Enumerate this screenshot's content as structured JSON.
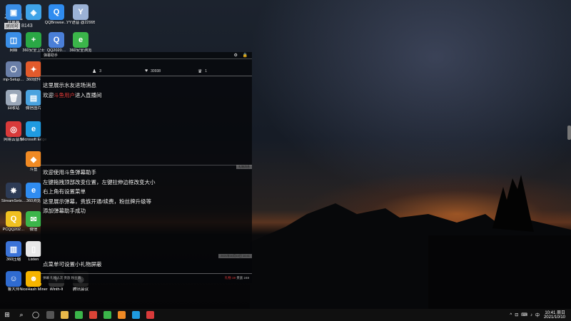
{
  "desktop_icons": [
    {
      "label": "此电脑",
      "color": "#3a8ee6",
      "glyph": "▣"
    },
    {
      "label": "",
      "color": "#3fa3e8",
      "glyph": "◈"
    },
    {
      "label": "QQBrowse…",
      "color": "#2f8cf0",
      "glyph": "Q"
    },
    {
      "label": "YY语音 @22995…",
      "color": "#9bb2d6",
      "glyph": "Y"
    },
    {
      "label": "网络",
      "color": "#3a8ee6",
      "glyph": "◫"
    },
    {
      "label": "360安全卫士",
      "color": "#2aa845",
      "glyph": "+"
    },
    {
      "label": "QQ2020…",
      "color": "#4a7fd8",
      "glyph": "Q"
    },
    {
      "label": "360安全浏览",
      "color": "#3bb54a",
      "glyph": "e"
    },
    {
      "label": "mp-Setup…",
      "color": "#6a7fa8",
      "glyph": "⎔"
    },
    {
      "label": "360软件",
      "color": "#e25a2b",
      "glyph": "✦"
    },
    {
      "label": "回收站",
      "color": "#9aa7b8",
      "glyph": "🗑"
    },
    {
      "label": "微信图片",
      "color": "#4aa3df",
      "glyph": "▤"
    },
    {
      "label": "网易云音乐",
      "color": "#d83a3a",
      "glyph": "◎"
    },
    {
      "label": "Microsoft Edge",
      "color": "#1f9be0",
      "glyph": "e"
    },
    {
      "label": "斗鱼",
      "color": "#f08a24",
      "glyph": "◆"
    },
    {
      "label": "StreamSets…",
      "color": "#2d3b55",
      "glyph": "✸"
    },
    {
      "label": "360浏览",
      "color": "#2f8cf0",
      "glyph": "e"
    },
    {
      "label": "PCQQ202…",
      "color": "#f0c020",
      "glyph": "Q"
    },
    {
      "label": "微信",
      "color": "#3bb54a",
      "glyph": "✉"
    },
    {
      "label": "360压缩",
      "color": "#3b73d8",
      "glyph": "▥"
    },
    {
      "label": "Listen",
      "color": "#e8e8e8",
      "glyph": "▯"
    },
    {
      "label": "鲁大师",
      "color": "#2f6bd0",
      "glyph": "☺"
    },
    {
      "label": "NiceHash Miner",
      "color": "#f5b400",
      "glyph": "☻"
    },
    {
      "label": "Winth-It",
      "color": "#333333",
      "glyph": "✦"
    },
    {
      "label": "腾讯会议",
      "color": "#222222",
      "glyph": "◉"
    }
  ],
  "watermark": {
    "brand": "斗鱼",
    "room_label": "房间号",
    "room_number": "8143"
  },
  "danmu": {
    "title": "弹幕助手",
    "stats": [
      {
        "icon": "♟",
        "value": "3"
      },
      {
        "icon": "♥",
        "value": "30938"
      },
      {
        "icon": "♛",
        "value": "1"
      }
    ],
    "top_messages": [
      "这里展示水友进场消息",
      {
        "prefix": "欢迎",
        "name": "斗鱼用户",
        "suffix": "进入直播间"
      }
    ],
    "separator_tag": "礼物消息",
    "chat_messages": [
      "欢迎使用斗鱼弹幕助手",
      "左键拖拽顶部改变位置，左键拉伸边框改变大小",
      "右上角有设置菜单",
      "这里展示弹幕，贵族开通/续费，粉丝牌升级等",
      "添加弹幕助手成功"
    ],
    "timestamp_tag": "2021年10月10日 10:41",
    "gift_message": "点菜单可设置小礼物屏蔽",
    "bottom_left": "弹幕 礼物人次 贵族 粉丝牌",
    "bottom_right": {
      "red": "礼物 19",
      "rest": "贵族 248"
    }
  },
  "taskbar": {
    "start": "⊞",
    "search": "⌕",
    "task_view": "◯",
    "apps": [
      {
        "name": "task-view",
        "color": "#555555"
      },
      {
        "name": "file-explorer",
        "color": "#e8b84a"
      },
      {
        "name": "360-browser",
        "color": "#3bb54a"
      },
      {
        "name": "chrome",
        "color": "#db4437"
      },
      {
        "name": "wechat",
        "color": "#3bb54a"
      },
      {
        "name": "douyu",
        "color": "#f08a24"
      },
      {
        "name": "edge",
        "color": "#1f9be0"
      },
      {
        "name": "netease-music",
        "color": "#d83a3a"
      }
    ],
    "tray_icons": [
      "^",
      "⊡",
      "⌨",
      "♪",
      "中"
    ],
    "time": "10:41 周日",
    "date": "2021/10/10"
  }
}
